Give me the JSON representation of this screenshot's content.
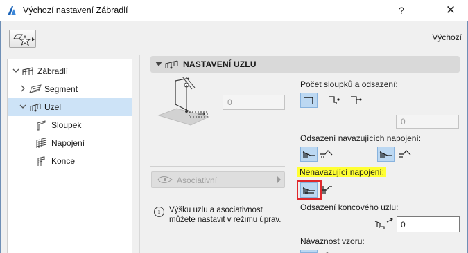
{
  "window": {
    "title": "Výchozí nastavení Zábradlí",
    "help_label": "?",
    "close_label": "✕"
  },
  "toolbar": {
    "favorites_icon": "star-favorites-icon",
    "default_label": "Výchozí"
  },
  "tree": {
    "items": [
      {
        "label": "Zábradlí",
        "icon": "railing-icon"
      },
      {
        "label": "Segment",
        "icon": "segment-icon"
      },
      {
        "label": "Uzel",
        "icon": "node-icon"
      },
      {
        "label": "Sloupek",
        "icon": "post-icon"
      },
      {
        "label": "Napojení",
        "icon": "connection-icon"
      },
      {
        "label": "Konce",
        "icon": "end-icon"
      }
    ],
    "selected": "Uzel"
  },
  "panel": {
    "title": "NASTAVENÍ UZLU",
    "node_height_value": "0",
    "associative_label": "Asociativní",
    "info_text": "Výšku uzlu a asociativnost můžete nastavit v režimu úprav.",
    "posts_offset_label": "Počet sloupků a odsazení:",
    "posts_offset_value": "0",
    "connected_offset_label": "Odsazení navazujících napojení:",
    "non_connected_label": "Nenavazující napojení:",
    "end_node_offset_label": "Odsazení koncového uzlu:",
    "end_node_offset_value": "0",
    "pattern_continuity_label": "Návaznost vzoru:"
  },
  "colors": {
    "selection": "#cde3f7",
    "highlight": "#ffff33",
    "red_outline": "#e0282c",
    "active_button": "#bcd8f2"
  }
}
